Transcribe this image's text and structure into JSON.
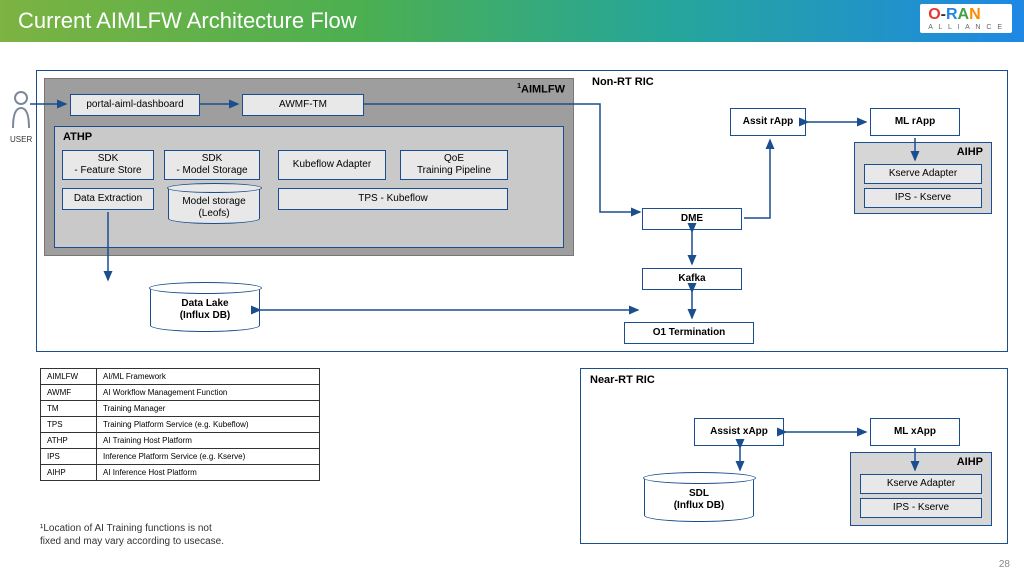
{
  "header": {
    "title": "Current AIMLFW Architecture Flow"
  },
  "logo": {
    "main": "O-RAN",
    "sub": "A L L I A N C E"
  },
  "user_label": "USER",
  "aimlfw": {
    "title": "AIMLFW",
    "sup": "1",
    "portal": "portal-aiml-dashboard",
    "awmf": "AWMF-TM",
    "athp": {
      "title": "ATHP",
      "sdk_fs": "SDK\n- Feature Store",
      "sdk_ms": "SDK\n- Model Storage",
      "kubeflow_adapter": "Kubeflow Adapter",
      "qoe": "QoE\nTraining Pipeline",
      "data_extraction": "Data Extraction",
      "model_storage": "Model storage\n(Leofs)",
      "tps": "TPS - Kubeflow"
    },
    "datalake": "Data Lake\n(Influx DB)"
  },
  "nonrt": {
    "title": "Non-RT RIC",
    "assist": "Assit rApp",
    "ml": "ML rApp",
    "aihp": {
      "title": "AIHP",
      "kserve_adapter": "Kserve Adapter",
      "ips": "IPS - Kserve"
    },
    "dme": "DME",
    "kafka": "Kafka",
    "o1": "O1 Termination"
  },
  "nearrt": {
    "title": "Near-RT RIC",
    "assist": "Assist xApp",
    "ml": "ML xApp",
    "aihp": {
      "title": "AIHP",
      "kserve_adapter": "Kserve Adapter",
      "ips": "IPS - Kserve"
    },
    "sdl": "SDL\n(Influx DB)"
  },
  "glossary": [
    [
      "AIMLFW",
      "AI/ML Framework"
    ],
    [
      "AWMF",
      "AI Workflow Management Function"
    ],
    [
      "TM",
      "Training Manager"
    ],
    [
      "TPS",
      "Training Platform Service (e.g. Kubeflow)"
    ],
    [
      "ATHP",
      "AI Training Host Platform"
    ],
    [
      "IPS",
      "Inference Platform Service (e.g. Kserve)"
    ],
    [
      "AIHP",
      "AI Inference Host Platform"
    ]
  ],
  "footnote": "¹Location of AI Training functions is not\nfixed and may vary according to usecase.",
  "pagenum": "28"
}
